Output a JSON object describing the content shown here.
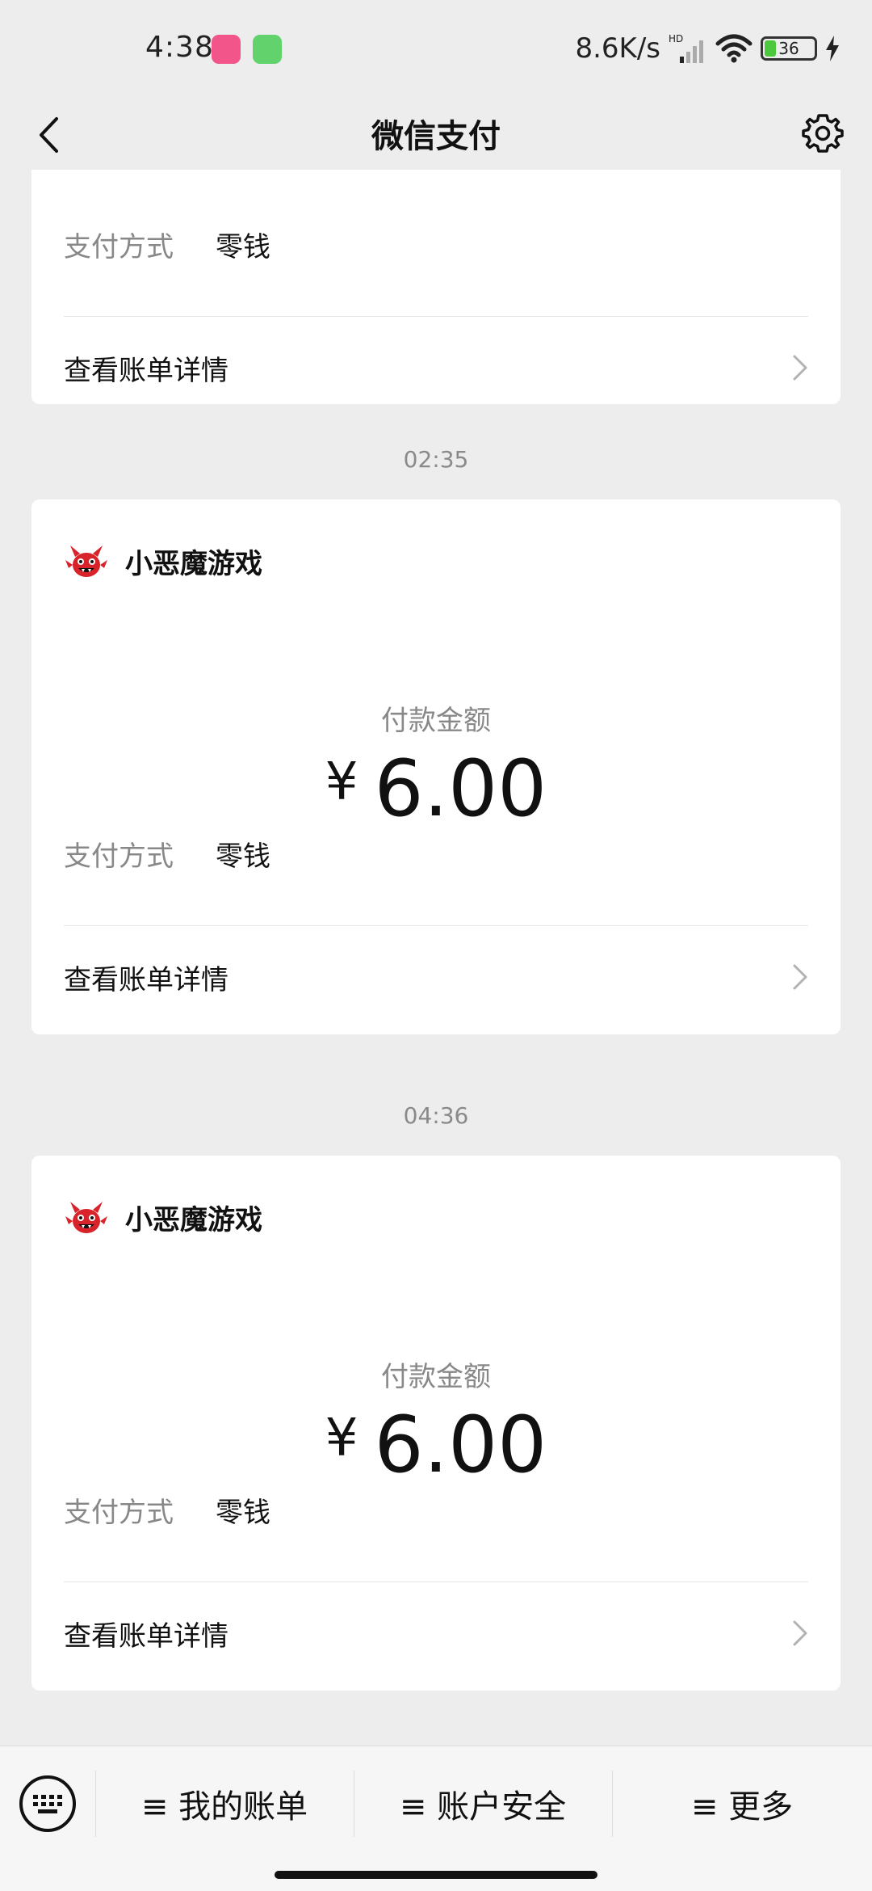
{
  "status": {
    "time": "4:38",
    "net_speed": "8.6K/s",
    "battery": "36"
  },
  "header": {
    "title": "微信支付"
  },
  "cards": [
    {
      "pay_method_label": "支付方式",
      "pay_method_value": "零钱",
      "detail_label": "查看账单详情"
    },
    {
      "time": "02:35",
      "merchant": "小恶魔游戏",
      "amount_label": "付款金额",
      "currency": "¥",
      "amount": "6.00",
      "pay_method_label": "支付方式",
      "pay_method_value": "零钱",
      "detail_label": "查看账单详情"
    },
    {
      "time": "04:36",
      "merchant": "小恶魔游戏",
      "amount_label": "付款金额",
      "currency": "¥",
      "amount": "6.00",
      "pay_method_label": "支付方式",
      "pay_method_value": "零钱",
      "detail_label": "查看账单详情"
    }
  ],
  "bottom_menu": {
    "bills": "≡ 我的账单",
    "security": "≡ 账户安全",
    "more": "≡ 更多"
  },
  "colors": {
    "background": "#ededed",
    "card": "#ffffff",
    "secondary_text": "#888888",
    "merchant_icon_red": "#d8232a"
  }
}
